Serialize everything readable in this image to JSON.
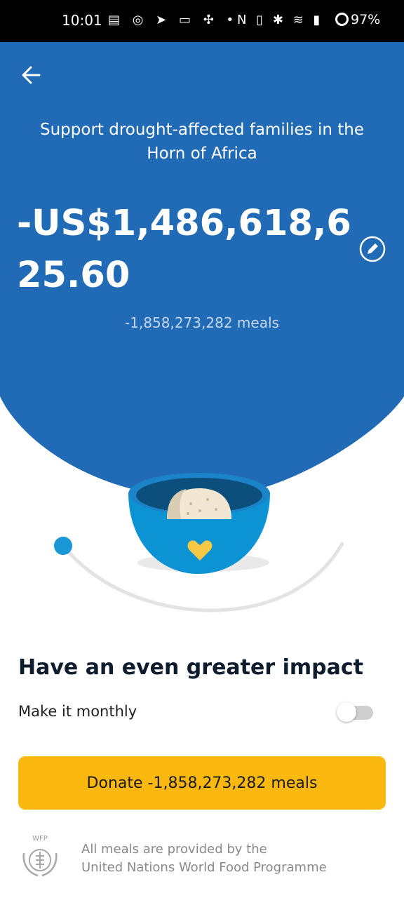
{
  "status_bar": {
    "time": "10:01",
    "left_icons": "▤ ◎ ➤ ▭ ✣ •",
    "right_icons": "N ▯ ✱ ≋ ▮",
    "battery": "97%"
  },
  "header": {
    "back_icon": "arrow-left-icon",
    "title": "Support drought-affected families in the Horn of Africa",
    "amount": "-US$1,486,618,625.60",
    "meals": "-1,858,273,282 meals",
    "edit_icon": "pencil-icon"
  },
  "impact": {
    "heading": "Have an even greater impact",
    "monthly_label": "Make it monthly",
    "monthly_enabled": false
  },
  "donate": {
    "label": "Donate -1,858,273,282 meals"
  },
  "footer": {
    "logo_text": "WFP",
    "line1": "All meals are provided by the",
    "line2": "United Nations World Food Programme"
  },
  "colors": {
    "primary_blue": "#216bb6",
    "donate_yellow": "#fbb80f",
    "heart_yellow": "#f7c843",
    "slider_blue": "#1996d5"
  }
}
